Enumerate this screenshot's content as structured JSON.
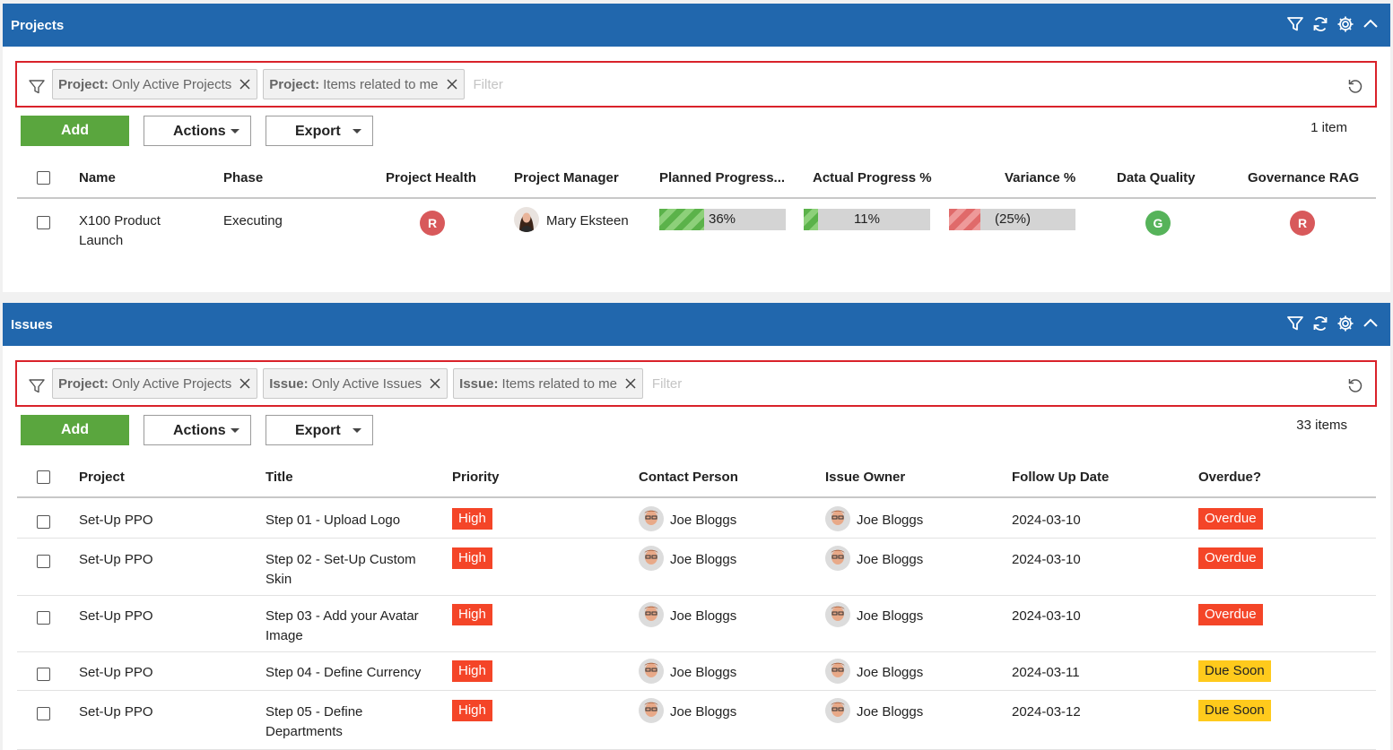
{
  "projects": {
    "title": "Projects",
    "filters": [
      {
        "key": "Project:",
        "value": "Only Active Projects"
      },
      {
        "key": "Project:",
        "value": "Items related to me"
      }
    ],
    "filter_placeholder": "Filter",
    "add_label": "Add",
    "actions_label": "Actions",
    "export_label": "Export",
    "count": "1 item",
    "columns": [
      "Name",
      "Phase",
      "Project Health",
      "Project Manager",
      "Planned Progress...",
      "Actual Progress %",
      "Variance %",
      "Data Quality",
      "Governance RAG"
    ],
    "rows": [
      {
        "name_line1": "X100 Product",
        "name_line2": "Launch",
        "phase": "Executing",
        "health": "R",
        "manager": "Mary Eksteen",
        "planned_progress": 36,
        "planned_label": "36%",
        "actual_progress": 11,
        "actual_label": "11%",
        "variance": 25,
        "variance_label": "(25%)",
        "data_quality": "G",
        "governance": "R"
      }
    ]
  },
  "issues": {
    "title": "Issues",
    "filters": [
      {
        "key": "Project:",
        "value": "Only Active Projects"
      },
      {
        "key": "Issue:",
        "value": "Only Active Issues"
      },
      {
        "key": "Issue:",
        "value": "Items related to me"
      }
    ],
    "filter_placeholder": "Filter",
    "add_label": "Add",
    "actions_label": "Actions",
    "export_label": "Export",
    "count": "33 items",
    "columns": [
      "Project",
      "Title",
      "Priority",
      "Contact Person",
      "Issue Owner",
      "Follow Up Date",
      "Overdue?"
    ],
    "rows": [
      {
        "project": "Set-Up PPO",
        "title1": "Step 01 - Upload Logo",
        "title2": "",
        "priority": "High",
        "contact": "Joe Bloggs",
        "owner": "Joe Bloggs",
        "date": "2024-03-10",
        "overdue": "Overdue"
      },
      {
        "project": "Set-Up PPO",
        "title1": "Step 02 - Set-Up Custom",
        "title2": "Skin",
        "priority": "High",
        "contact": "Joe Bloggs",
        "owner": "Joe Bloggs",
        "date": "2024-03-10",
        "overdue": "Overdue"
      },
      {
        "project": "Set-Up PPO",
        "title1": "Step 03 - Add your Avatar",
        "title2": "Image",
        "priority": "High",
        "contact": "Joe Bloggs",
        "owner": "Joe Bloggs",
        "date": "2024-03-10",
        "overdue": "Overdue"
      },
      {
        "project": "Set-Up PPO",
        "title1": "Step 04 - Define Currency",
        "title2": "",
        "priority": "High",
        "contact": "Joe Bloggs",
        "owner": "Joe Bloggs",
        "date": "2024-03-11",
        "overdue": "Due Soon"
      },
      {
        "project": "Set-Up PPO",
        "title1": "Step 05 - Define",
        "title2": "Departments",
        "priority": "High",
        "contact": "Joe Bloggs",
        "owner": "Joe Bloggs",
        "date": "2024-03-12",
        "overdue": "Due Soon"
      }
    ]
  },
  "colors": {
    "header_blue": "#2167ad",
    "add_green": "#5aa63e",
    "filter_border_red": "#d9222a",
    "rag_red": "#d8595b",
    "rag_green": "#56b35a",
    "high_red": "#f44528",
    "due_soon_yellow": "#ffca1c"
  },
  "icons": [
    "filter-icon",
    "refresh-icon",
    "gear-icon",
    "chevron-up-icon",
    "close-icon",
    "reset-icon",
    "caret-down-icon"
  ]
}
